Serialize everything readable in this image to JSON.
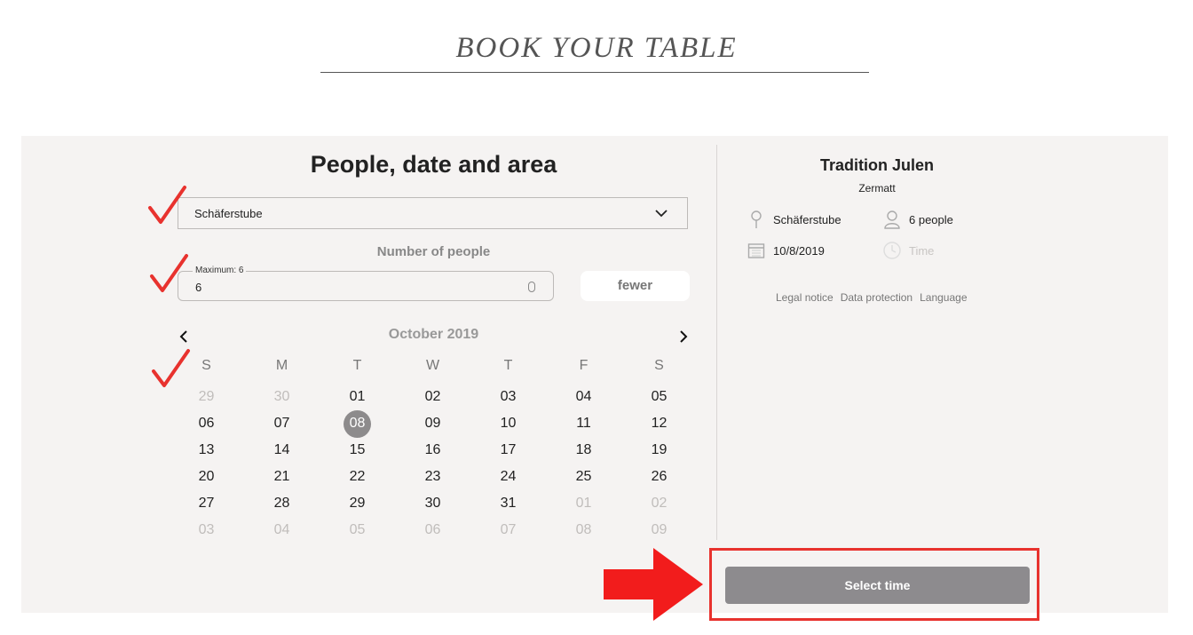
{
  "header": {
    "title": "BOOK YOUR TABLE"
  },
  "form": {
    "title": "People, date and area",
    "area": {
      "selected": "Schäferstube"
    },
    "people": {
      "label": "Number of people",
      "legend": "Maximum: 6",
      "value": "6",
      "fewer_label": "fewer"
    }
  },
  "calendar": {
    "month": "October 2019",
    "weekdays": [
      "S",
      "M",
      "T",
      "W",
      "T",
      "F",
      "S"
    ],
    "weeks": [
      [
        {
          "d": "29",
          "m": true
        },
        {
          "d": "30",
          "m": true
        },
        {
          "d": "01"
        },
        {
          "d": "02"
        },
        {
          "d": "03"
        },
        {
          "d": "04"
        },
        {
          "d": "05"
        }
      ],
      [
        {
          "d": "06"
        },
        {
          "d": "07"
        },
        {
          "d": "08",
          "s": true
        },
        {
          "d": "09"
        },
        {
          "d": "10"
        },
        {
          "d": "11"
        },
        {
          "d": "12"
        }
      ],
      [
        {
          "d": "13"
        },
        {
          "d": "14"
        },
        {
          "d": "15"
        },
        {
          "d": "16"
        },
        {
          "d": "17"
        },
        {
          "d": "18"
        },
        {
          "d": "19"
        }
      ],
      [
        {
          "d": "20"
        },
        {
          "d": "21"
        },
        {
          "d": "22"
        },
        {
          "d": "23"
        },
        {
          "d": "24"
        },
        {
          "d": "25"
        },
        {
          "d": "26"
        }
      ],
      [
        {
          "d": "27"
        },
        {
          "d": "28"
        },
        {
          "d": "29"
        },
        {
          "d": "30"
        },
        {
          "d": "31"
        },
        {
          "d": "01",
          "m": true
        },
        {
          "d": "02",
          "m": true
        }
      ],
      [
        {
          "d": "03",
          "m": true
        },
        {
          "d": "04",
          "m": true
        },
        {
          "d": "05",
          "m": true
        },
        {
          "d": "06",
          "m": true
        },
        {
          "d": "07",
          "m": true
        },
        {
          "d": "08",
          "m": true
        },
        {
          "d": "09",
          "m": true
        }
      ]
    ]
  },
  "summary": {
    "restaurant": "Tradition Julen",
    "city": "Zermatt",
    "area": "Schäferstube",
    "people": "6 people",
    "date": "10/8/2019",
    "time": "Time"
  },
  "footer": {
    "legal": "Legal notice",
    "privacy": "Data protection",
    "language": "Language"
  },
  "actions": {
    "select_time": "Select time"
  },
  "colors": {
    "panel_bg": "#f5f3f2",
    "annotation_red": "#e8322e",
    "button_gray": "#8d8b8e"
  },
  "icons": {
    "area_pin": "pin-icon",
    "people": "person-icon",
    "date": "calendar-icon",
    "time": "clock-icon",
    "dropdown": "chevron-down-icon",
    "prev": "chevron-left-icon",
    "next": "chevron-right-icon"
  }
}
